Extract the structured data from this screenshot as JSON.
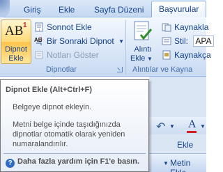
{
  "tabs": {
    "home": "Giriş",
    "insert": "Ekle",
    "page_layout": "Sayfa Düzeni",
    "references": "Başvurular"
  },
  "footnotes_group": {
    "big_button_icon": "AB",
    "big_button_superscript": "1",
    "big_button_line1": "Dipnot",
    "big_button_line2": "Ekle",
    "endnote": "Sonnot Ekle",
    "next_footnote": "Bir Sonraki Dipnot",
    "show_notes": "Notları Göster",
    "group_label": "Dipnotlar"
  },
  "citations_group": {
    "insert_citation_line1": "Alıntı",
    "insert_citation_line2": "Ekle",
    "manage_sources": "Kaynakla",
    "style_label": "Stil:",
    "style_value": "APA",
    "bibliography": "Kaynakça",
    "group_label": "Alıntılar ve Kayna"
  },
  "tooltip": {
    "title": "Dipnot Ekle (Alt+Ctrl+F)",
    "line1": "Belgeye dipnot ekleyin.",
    "line2": "Metni belge içinde taşıdığınızda dipnotlar otomatik olarak yeniden numaralandırılır.",
    "help": "Daha fazla yardım için F1'e basın."
  },
  "background_window": {
    "insert_tab": "Ekle",
    "insert_text": "Metin Ekle"
  },
  "colors": {
    "accent": "#15428b",
    "highlight": "#ffd975",
    "ribbon": "#dbe7f7"
  }
}
